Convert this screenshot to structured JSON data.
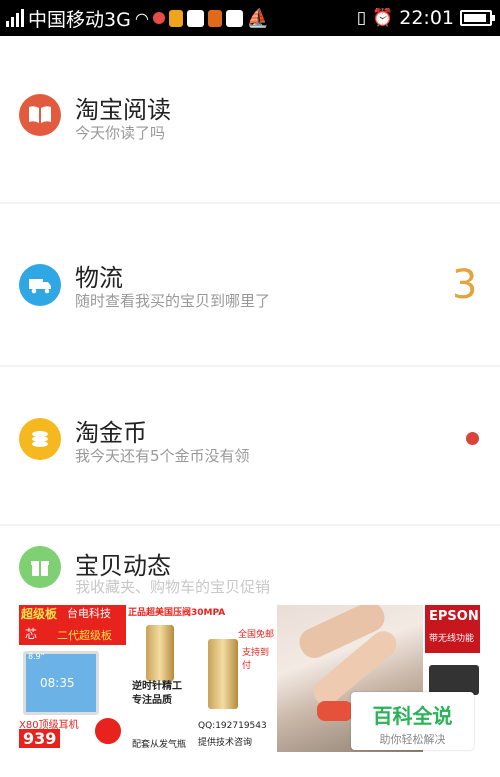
{
  "status_bar": {
    "carrier": "中国移动3G",
    "time": "22:01"
  },
  "rows": [
    {
      "title": "淘宝阅读",
      "subtitle": "今天你读了吗",
      "icon": "book-icon",
      "color": "#e25b3f"
    },
    {
      "title": "物流",
      "subtitle": "随时查看我买的宝贝到哪里了",
      "icon": "truck-icon",
      "color": "#2fa7e4",
      "count": "3"
    },
    {
      "title": "淘金币",
      "subtitle": "我今天还有5个金币没有领",
      "icon": "coins-icon",
      "color": "#f6b81f"
    },
    {
      "title": "宝贝动态",
      "subtitle": "我收藏夹、购物车的宝贝促销",
      "icon": "gift-icon",
      "color": "#7fcf73"
    }
  ],
  "promos": [
    {
      "lines": [
        "超级板",
        "芯",
        "二代超级板",
        "台电科技",
        "8.9\"",
        "08:35",
        "X80顶级耳机",
        "939"
      ]
    },
    {
      "lines": [
        "正品超美国压阀30MPA",
        "全国免邮",
        "支持到付",
        "逆时针精工",
        "专注品质",
        "配套从发气瓶",
        "QQ:192719543",
        "提供技术咨询"
      ]
    },
    {
      "lines": []
    },
    {
      "lines": [
        "EPSON",
        "带无线功能"
      ]
    }
  ],
  "watermark": {
    "title": "百科全说",
    "subtitle": "助你轻松解决"
  }
}
